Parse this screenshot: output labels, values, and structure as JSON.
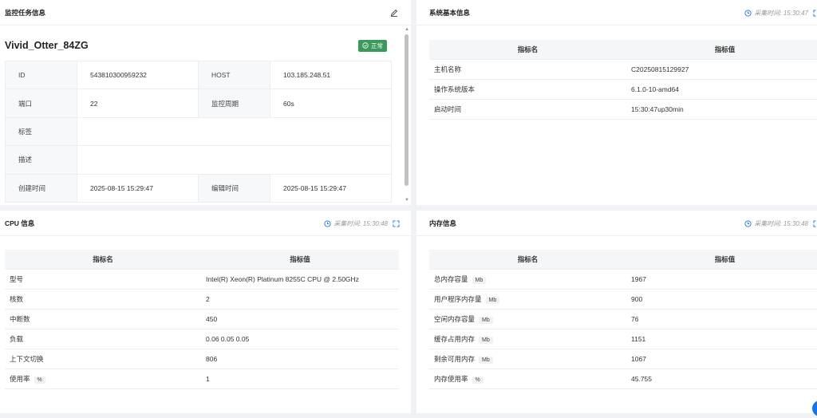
{
  "task_panel": {
    "title": "监控任务信息",
    "task_name": "Vivid_Otter_84ZG",
    "status": "正常",
    "status_color": "#3a9a5b",
    "fields": {
      "id_label": "ID",
      "id_value": "543810300959232",
      "host_label": "HOST",
      "host_value": "103.185.248.51",
      "port_label": "端口",
      "port_value": "22",
      "period_label": "监控周期",
      "period_value": "60s",
      "tag_label": "标签",
      "tag_value": "",
      "desc_label": "描述",
      "desc_value": "",
      "created_label": "创建时间",
      "created_value": "2025-08-15 15:29:47",
      "edited_label": "编辑时间",
      "edited_value": "2025-08-15 15:29:47"
    }
  },
  "system_panel": {
    "title": "系统基本信息",
    "collect_time": "采集时间: 15:30:47",
    "col_name": "指标名",
    "col_value": "指标值",
    "rows": [
      {
        "name": "主机名称",
        "value": "C20250815129927"
      },
      {
        "name": "操作系统版本",
        "value": "6.1.0-10-amd64"
      },
      {
        "name": "启动时间",
        "value": "15:30:47up30min"
      }
    ]
  },
  "cpu_panel": {
    "title": "CPU 信息",
    "collect_time": "采集时间: 15:30:48",
    "col_name": "指标名",
    "col_value": "指标值",
    "rows": [
      {
        "name": "型号",
        "unit": "",
        "value": "Intel(R) Xeon(R) Platinum 8255C CPU @ 2.50GHz"
      },
      {
        "name": "核数",
        "unit": "",
        "value": "2"
      },
      {
        "name": "中断数",
        "unit": "",
        "value": "450"
      },
      {
        "name": "负载",
        "unit": "",
        "value": "0.06 0.05 0.05"
      },
      {
        "name": "上下文切换",
        "unit": "",
        "value": "806"
      },
      {
        "name": "使用率",
        "unit": "%",
        "value": "1"
      }
    ]
  },
  "memory_panel": {
    "title": "内存信息",
    "collect_time": "采集时间: 15:30:48",
    "col_name": "指标名",
    "col_value": "指标值",
    "rows": [
      {
        "name": "总内存容量",
        "unit": "Mb",
        "value": "1967"
      },
      {
        "name": "用户程序内存量",
        "unit": "Mb",
        "value": "900"
      },
      {
        "name": "空闲内存容量",
        "unit": "Mb",
        "value": "76"
      },
      {
        "name": "缓存占用内存",
        "unit": "Mb",
        "value": "1151"
      },
      {
        "name": "剩余可用内存",
        "unit": "Mb",
        "value": "1067"
      },
      {
        "name": "内存使用率",
        "unit": "%",
        "value": "45.755"
      }
    ]
  },
  "icons": {
    "edit": "edit-icon",
    "clock": "clock-icon",
    "expand": "expand-icon",
    "status": "check-circle-icon"
  },
  "colors": {
    "accent": "#1a73e8",
    "success": "#3a9a5b"
  }
}
